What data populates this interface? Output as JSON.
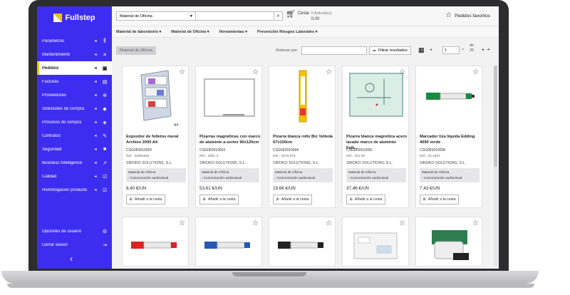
{
  "app": {
    "name": "Fullstep"
  },
  "sidebar": {
    "items": [
      {
        "label": "Parametros",
        "icon": "sliders-icon"
      },
      {
        "label": "Mantenimiento",
        "icon": "tools-icon"
      },
      {
        "label": "Pedidos",
        "icon": "order-icon",
        "active": true
      },
      {
        "label": "Facturas",
        "icon": "invoice-icon"
      },
      {
        "label": "Proveedores",
        "icon": "cart-plus-icon"
      },
      {
        "label": "Solicitudes de compra",
        "icon": "tag-icon"
      },
      {
        "label": "Procesos de compra",
        "icon": "layers-icon"
      },
      {
        "label": "Contratos",
        "icon": "pen-icon"
      },
      {
        "label": "Seguridad",
        "icon": "lock-icon"
      },
      {
        "label": "Business Intelligence",
        "icon": "chart-icon"
      },
      {
        "label": "Calidad",
        "icon": "checklist-icon"
      },
      {
        "label": "Homologacion producto",
        "icon": "check-doc-icon"
      }
    ],
    "bottom": [
      {
        "label": "Opciones de usuario",
        "icon": "gear-icon"
      },
      {
        "label": "Cerrar sesión",
        "icon": "logout-icon"
      }
    ]
  },
  "header": {
    "category_select": "Material de Oficina",
    "search_placeholder": "",
    "cart_label": "Cesta",
    "cart_count": "0 Articulo(s)",
    "cart_total": "0,00",
    "favorites_label": "Pedidos favoritos"
  },
  "categories": [
    "Material de laboratorio",
    "Material de Oficina",
    "Herramientas",
    "Prevención Riesgos Laborales"
  ],
  "toolbar": {
    "chip": "Material de Oficina",
    "order_label": "Ordenar por:",
    "filter_label": "Filtrar resultados",
    "page_value": "1",
    "page_x": "×",
    "page_of": "de",
    "page_total": "26"
  },
  "products": [
    {
      "name": "Expositor de folletos mural Archivo 2000 A4",
      "code": "CSG0F0010002",
      "ref": "Ref.: 32681591",
      "supplier": "SIROKO SOLUTIONS, S.L.",
      "tag1": "Material de Oficina",
      "tag2": "Comunicación audiovisual",
      "price": "8,40 €/UN",
      "add": "Añadir a la cesta",
      "tag_label": "A4"
    },
    {
      "name": "Pizarras magnéticas con marco de aluminio a-series 90x120cm",
      "code": "CSG0F0010003",
      "ref": "Ref.: 2681.3",
      "supplier": "SIROKO SOLUTIONS, S.L.",
      "tag1": "Material de Oficina",
      "tag2": "Comunicación audiovisual",
      "price": "53,61 €/UN",
      "add": "Añadir a la cesta"
    },
    {
      "name": "Pizarra blanca rollo Bic Velleda 67x100cm",
      "code": "CSG0F0010004",
      "ref": "Ref.: 2678.979",
      "supplier": "SIROKO SOLUTIONS, S.L.",
      "tag1": "Material de Oficina",
      "tag2": "Comunicación audiovisual",
      "price": "19,66 €/UN",
      "add": "Añadir a la cesta"
    },
    {
      "name": "Pizarra blanca magnética acero lacado marco de aluminio Faib...",
      "code": "CSG0F0010005",
      "ref": "Ref.: 441.50",
      "supplier": "SIROKO SOLUTIONS, S.L.",
      "tag1": "Material de Oficina",
      "tag2": "Comunicación audiovisual",
      "price": "37,46 €/UN",
      "add": "Añadir a la cesta"
    },
    {
      "name": "Marcador tiza líquida Edding 4090 verde",
      "code": "CSG0F0010006",
      "ref": "Ref.: 42.1807",
      "supplier": "SIROKO SOLUTIONS, S.L.",
      "tag1": "Material de Oficina",
      "tag2": "Comunicación audiovisual",
      "price": "7,43 €/UN",
      "add": "Añadir a la cesta"
    }
  ],
  "colors": {
    "sidebar": "#3d2df0",
    "active_marker": "#f5c400"
  }
}
